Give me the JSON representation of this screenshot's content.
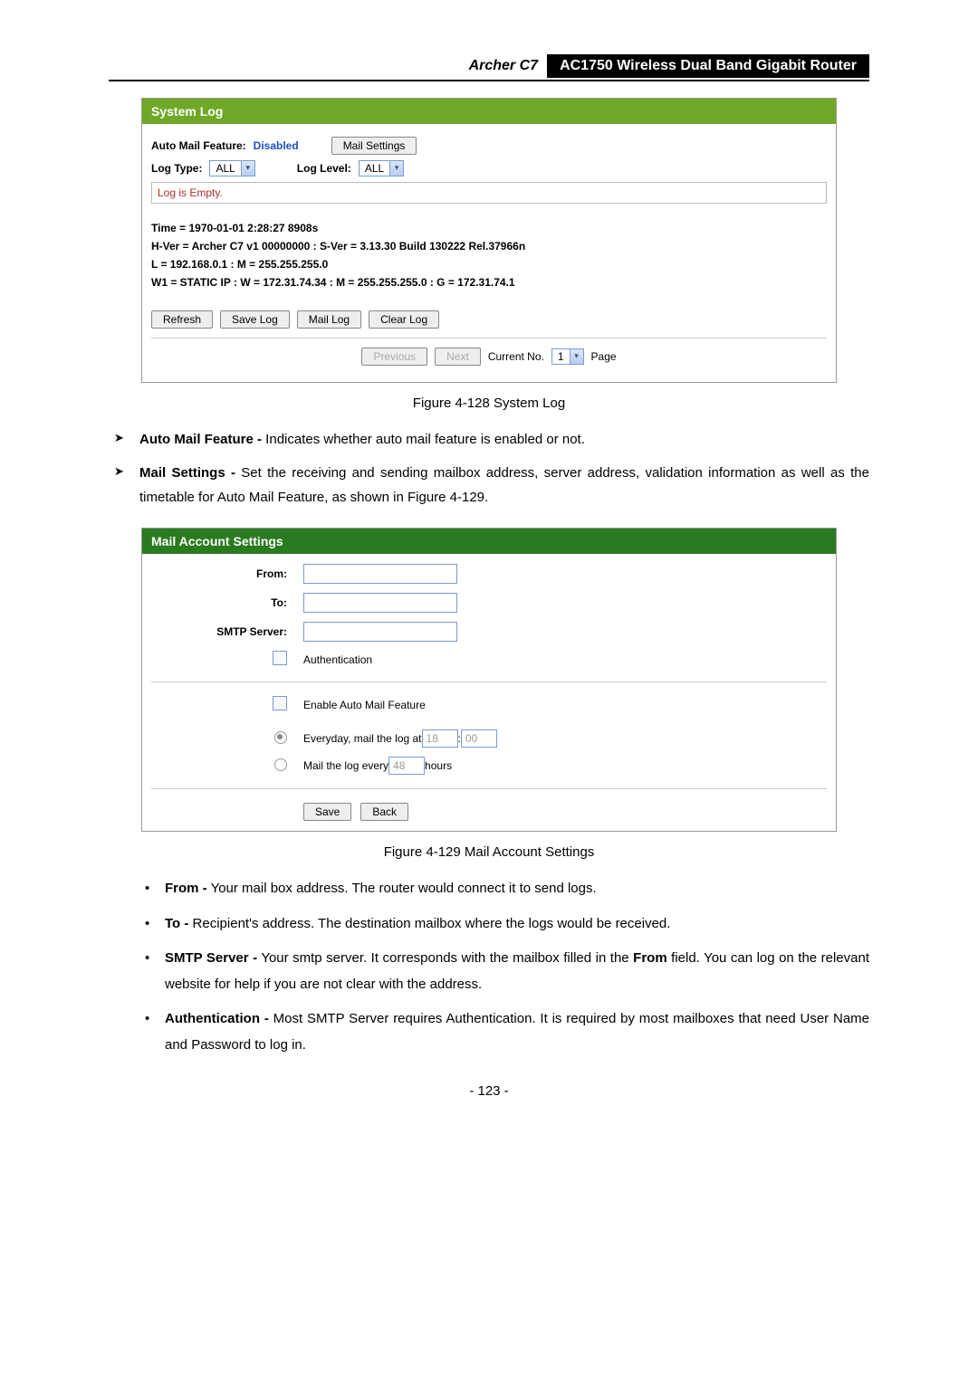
{
  "header": {
    "model": "Archer C7",
    "device": "AC1750 Wireless Dual Band Gigabit Router"
  },
  "shot1": {
    "title": "System Log",
    "automail_label": "Auto Mail Feature:",
    "automail_value": "Disabled",
    "mail_settings_btn": "Mail Settings",
    "logtype_label": "Log Type:",
    "logtype_value": "ALL",
    "loglevel_label": "Log Level:",
    "loglevel_value": "ALL",
    "log_empty": "Log is Empty.",
    "sys1": "Time = 1970-01-01 2:28:27 8908s",
    "sys2": "H-Ver = Archer C7 v1 00000000 : S-Ver = 3.13.30 Build 130222 Rel.37966n",
    "sys3": "L = 192.168.0.1 : M = 255.255.255.0",
    "sys4": "W1 = STATIC IP : W = 172.31.74.34 : M = 255.255.255.0 : G = 172.31.74.1",
    "btn_refresh": "Refresh",
    "btn_savelog": "Save Log",
    "btn_maillog": "Mail Log",
    "btn_clearlog": "Clear Log",
    "btn_prev": "Previous",
    "btn_next": "Next",
    "current_no_label": "Current No.",
    "current_no_value": "1",
    "page_label": "Page"
  },
  "caption1": "Figure 4-128 System Log",
  "bullets": {
    "b1_lead": "Auto Mail Feature -",
    "b1_text": " Indicates whether auto mail feature is enabled or not.",
    "b2_lead": "Mail Settings -",
    "b2_text": " Set the receiving and sending mailbox address, server address, validation information as well as the timetable for Auto Mail Feature, as shown in Figure 4-129."
  },
  "shot2": {
    "title": "Mail Account Settings",
    "from": "From:",
    "to": "To:",
    "smtp": "SMTP Server:",
    "auth": "Authentication",
    "enable": "Enable Auto Mail Feature",
    "ev_pre": "Everyday, mail the log at ",
    "ev_h": "18",
    "ev_sep": " : ",
    "ev_m": "00",
    "every_pre": "Mail the log every ",
    "every_v": "48",
    "every_suf": " hours",
    "save": "Save",
    "back": "Back"
  },
  "caption2": "Figure 4-129 Mail Account Settings",
  "dots": {
    "d1_lead": "From -",
    "d1_text": " Your mail box address. The router would connect it to send logs.",
    "d2_lead": "To -",
    "d2_text": " Recipient's address. The destination mailbox where the logs would be received.",
    "d3_lead": "SMTP Server -",
    "d3_text": " Your smtp server. It corresponds with the mailbox filled in the ",
    "d3_bold": "From",
    "d3_tail": " field. You can log on the relevant website for help if you are not clear with the address.",
    "d4_lead": "Authentication -",
    "d4_text": " Most SMTP Server requires Authentication. It is required by most mailboxes that need User Name and Password to log in."
  },
  "page_number": "- 123 -"
}
